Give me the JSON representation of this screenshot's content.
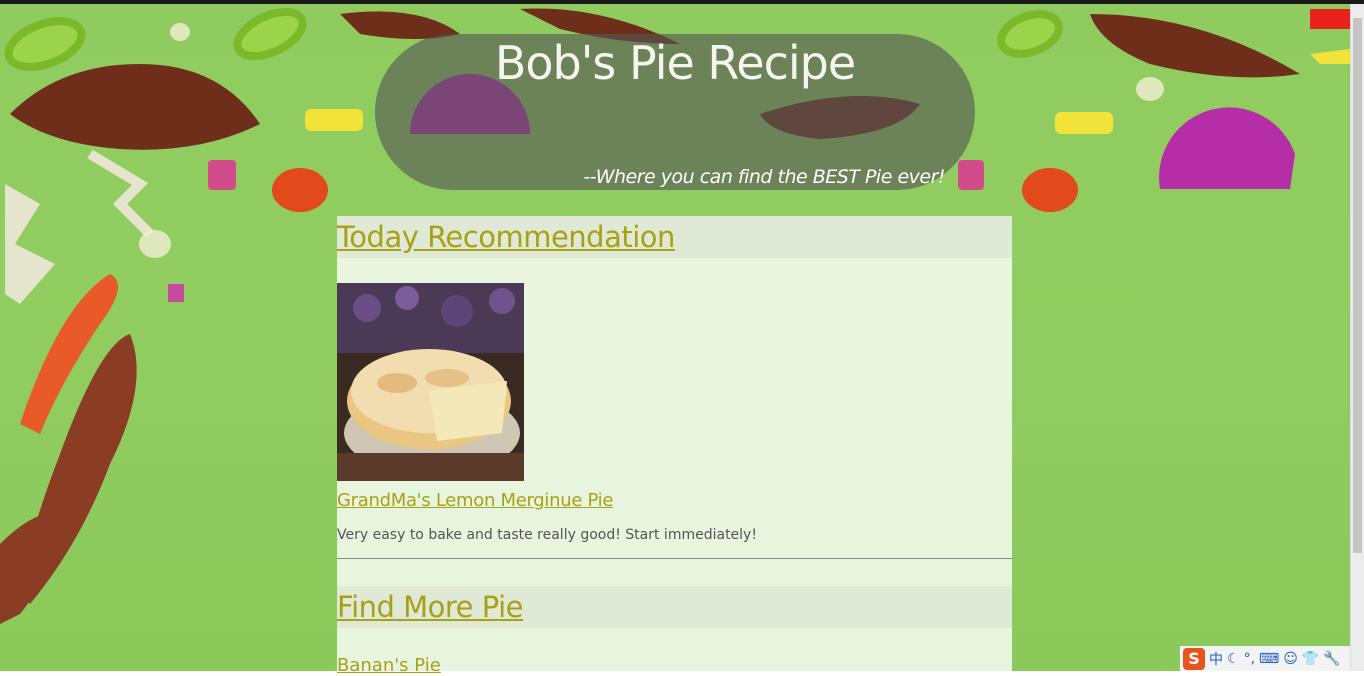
{
  "header": {
    "title": "Bob's Pie Recipe",
    "tagline": "--Where you can find the BEST Pie ever!"
  },
  "sections": {
    "today": {
      "heading": "Today Recommendation",
      "pie_name": "GrandMa's Lemon Merginue Pie",
      "description": "Very easy to bake and taste really good! Start immediately!"
    },
    "more": {
      "heading": "Find More Pie",
      "first_item": "Banan's Pie"
    }
  },
  "tray": {
    "logo": "S",
    "ime_mode": "中",
    "icons": [
      "moon-icon",
      "punctuation-icon",
      "keyboard-icon",
      "user-icon",
      "shirt-icon",
      "wrench-icon"
    ]
  },
  "colors": {
    "background": "#8fcb5f",
    "link": "#a7a116",
    "header_pill": "#555555"
  }
}
